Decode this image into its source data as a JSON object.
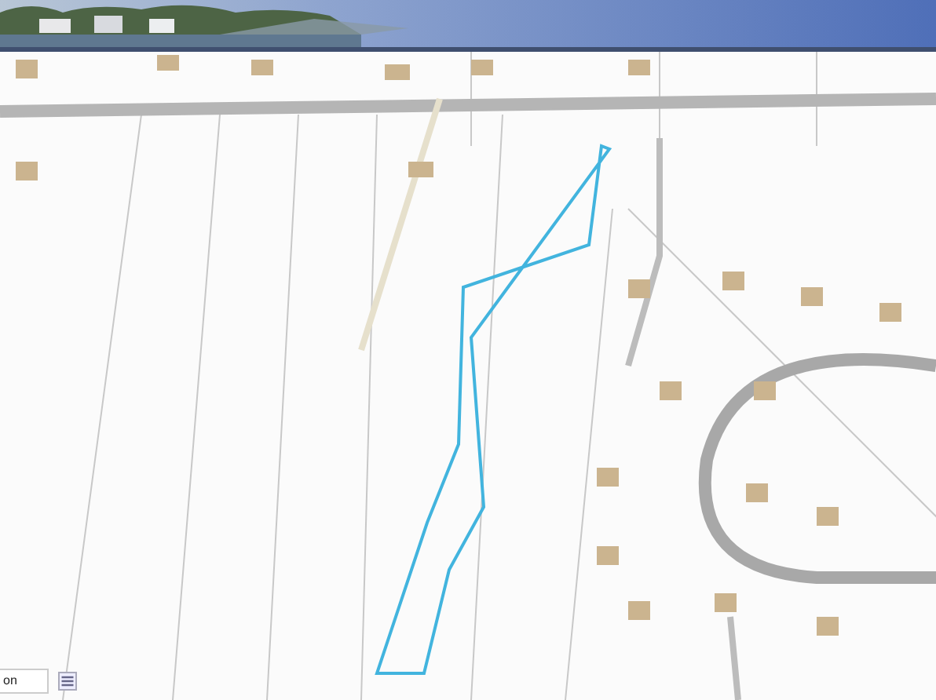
{
  "footer": {
    "field_value": "on"
  }
}
